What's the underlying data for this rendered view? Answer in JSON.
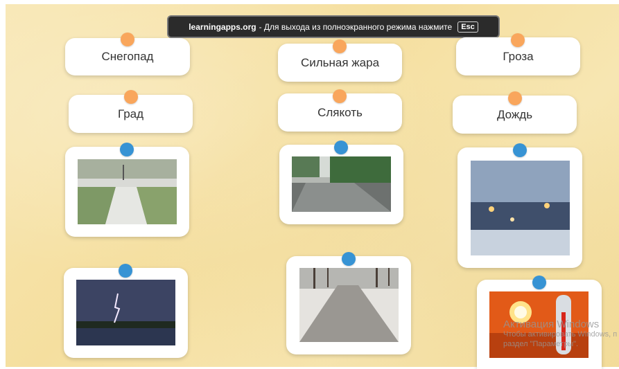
{
  "banner": {
    "site": "learningapps.org",
    "message": "- Для выхода из полноэкранного режима нажмите",
    "key": "Esc"
  },
  "labels": [
    {
      "text": "Снегопад"
    },
    {
      "text": "Сильная жара"
    },
    {
      "text": "Гроза"
    },
    {
      "text": "Град"
    },
    {
      "text": "Слякоть"
    },
    {
      "text": "Дождь"
    }
  ],
  "photos": [
    {
      "icon": "hail-photo"
    },
    {
      "icon": "rain-road-photo"
    },
    {
      "icon": "snowy-street-photo"
    },
    {
      "icon": "thunderstorm-photo"
    },
    {
      "icon": "slush-path-photo"
    },
    {
      "icon": "heat-thermometer-photo"
    }
  ],
  "watermark": {
    "line1": "Активация Windows",
    "line2": "Чтобы активировать Windows, п",
    "line3": "раздел \"Параметры\"."
  },
  "colors": {
    "orange_pin": "#f9a65c",
    "blue_pin": "#3793d4",
    "background": "#f7e4a9"
  }
}
